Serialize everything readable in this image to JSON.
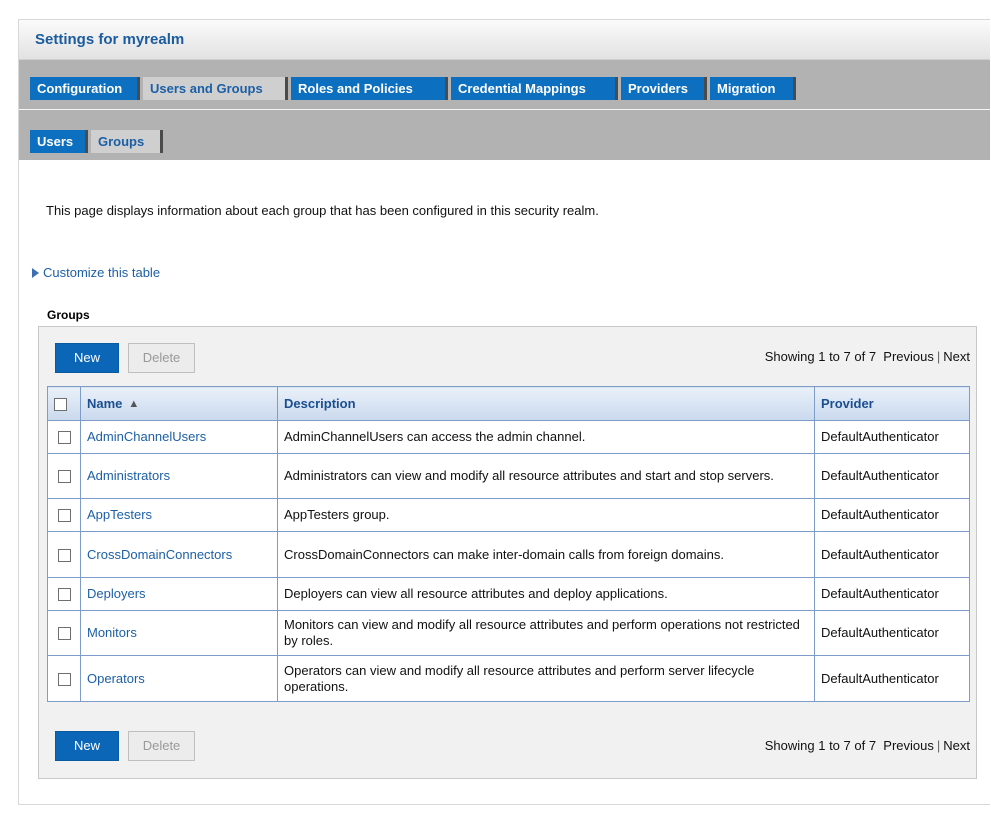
{
  "page": {
    "title": "Settings for myrealm",
    "intro": "This page displays information about each group that has been configured in this security realm.",
    "customize_link": "Customize this table",
    "section_label": "Groups"
  },
  "tabs": [
    {
      "label": "Configuration",
      "active": false
    },
    {
      "label": "Users and Groups",
      "active": true
    },
    {
      "label": "Roles and Policies",
      "active": false
    },
    {
      "label": "Credential Mappings",
      "active": false
    },
    {
      "label": "Providers",
      "active": false
    },
    {
      "label": "Migration",
      "active": false
    }
  ],
  "subtabs": [
    {
      "label": "Users",
      "active": false
    },
    {
      "label": "Groups",
      "active": true
    }
  ],
  "toolbar": {
    "new_label": "New",
    "delete_label": "Delete",
    "showing": "Showing 1 to 7 of 7",
    "previous": "Previous",
    "separator": "|",
    "next": "Next"
  },
  "table": {
    "columns": [
      "Name",
      "Description",
      "Provider"
    ],
    "rows": [
      {
        "name": "AdminChannelUsers",
        "description": "AdminChannelUsers can access the admin channel.",
        "provider": "DefaultAuthenticator"
      },
      {
        "name": "Administrators",
        "description": "Administrators can view and modify all resource attributes and start and stop servers.",
        "provider": "DefaultAuthenticator"
      },
      {
        "name": "AppTesters",
        "description": "AppTesters group.",
        "provider": "DefaultAuthenticator"
      },
      {
        "name": "CrossDomainConnectors",
        "description": "CrossDomainConnectors can make inter-domain calls from foreign domains.",
        "provider": "DefaultAuthenticator"
      },
      {
        "name": "Deployers",
        "description": "Deployers can view all resource attributes and deploy applications.",
        "provider": "DefaultAuthenticator"
      },
      {
        "name": "Monitors",
        "description": "Monitors can view and modify all resource attributes and perform operations not restricted by roles.",
        "provider": "DefaultAuthenticator"
      },
      {
        "name": "Operators",
        "description": "Operators can view and modify all resource attributes and perform server lifecycle operations.",
        "provider": "DefaultAuthenticator"
      }
    ]
  },
  "colors": {
    "tab_blue": "#0d6fc0",
    "link_blue": "#1d5fa6",
    "header_gray": "#b2b2b2"
  }
}
